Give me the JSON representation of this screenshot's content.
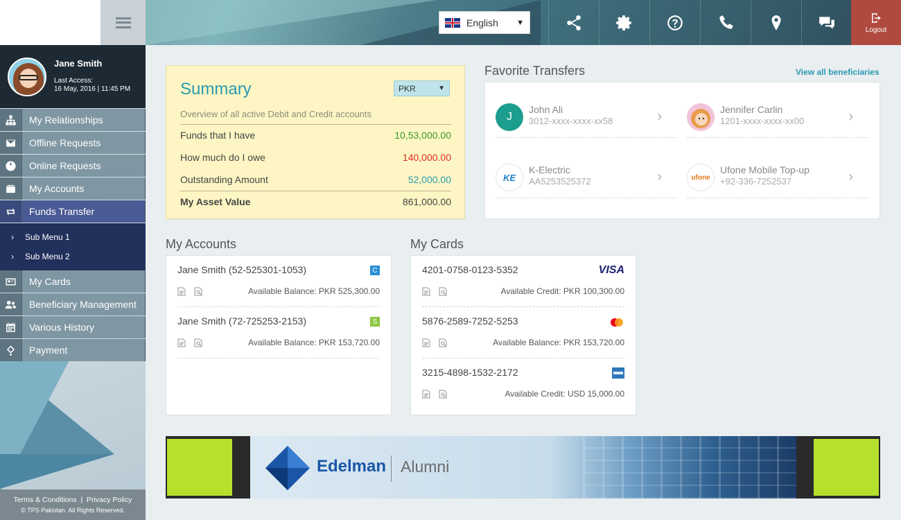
{
  "topbar": {
    "language": "English",
    "icons": [
      "share-icon",
      "gear-icon",
      "help-icon",
      "phone-icon",
      "location-icon",
      "chat-icon"
    ],
    "logout_label": "Logout"
  },
  "profile": {
    "name": "Jane Smith",
    "last_access_label": "Last Access:",
    "last_access_value": "16 May, 2016 | 11:45 PM"
  },
  "menu": {
    "items": [
      {
        "label": "My Relationships",
        "icon": "sitemap-icon"
      },
      {
        "label": "Offline Requests",
        "icon": "envelope-icon"
      },
      {
        "label": "Online Requests",
        "icon": "globe-icon"
      },
      {
        "label": "My Accounts",
        "icon": "wallet-icon"
      },
      {
        "label": "Funds Transfer",
        "icon": "transfer-icon"
      },
      {
        "label": "My Cards",
        "icon": "card-icon"
      },
      {
        "label": "Beneficiary Management",
        "icon": "users-icon"
      },
      {
        "label": "Various History",
        "icon": "calendar-icon"
      },
      {
        "label": "Payment",
        "icon": "payment-icon"
      }
    ],
    "submenu": [
      "Sub Menu 1",
      "Sub Menu 2"
    ]
  },
  "footer": {
    "terms": "Terms & Conditions",
    "sep": "|",
    "privacy": "Privacy Policy",
    "copyright": "© TPS Pakistan. All Rights Reserved."
  },
  "summary": {
    "title": "Summary",
    "currency": "PKR",
    "subtitle": "Overview of all active Debit and Credit accounts",
    "rows": [
      {
        "label": "Funds that I have",
        "value": "10,53,000.00",
        "color": "#3a9a2a"
      },
      {
        "label": "How much do I owe",
        "value": "140,000.00",
        "color": "#e02a2a"
      },
      {
        "label": "Outstanding Amount",
        "value": "52,000.00",
        "color": "#2a9ab0"
      }
    ],
    "asset_label": "My Asset Value",
    "asset_value": "861,000.00"
  },
  "favorites": {
    "title": "Favorite Transfers",
    "view_all": "View all beneficiaries",
    "items": [
      {
        "name": "John Ali",
        "account": "3012-xxxx-xxxx-xx58",
        "initial": "J"
      },
      {
        "name": "Jennifer Carlin",
        "account": "1201-xxxx-xxxx-xx00"
      },
      {
        "name": "K-Electric",
        "account": "AA5253525372",
        "logo": "KE"
      },
      {
        "name": "Ufone Mobile Top-up",
        "account": "+92-336-7252537",
        "logo": "ufone"
      }
    ]
  },
  "accounts": {
    "title": "My Accounts",
    "items": [
      {
        "name": "Jane Smith (52-525301-1053)",
        "badge": "C",
        "balance": "Available Balance: PKR 525,300.00"
      },
      {
        "name": "Jane Smith (72-725253-2153)",
        "badge": "S",
        "balance": "Available Balance: PKR 153,720.00"
      }
    ]
  },
  "cards": {
    "title": "My Cards",
    "items": [
      {
        "number": "4201-0758-0123-5352",
        "brand": "VISA",
        "balance": "Available Credit: PKR 100,300.00"
      },
      {
        "number": "5876-2589-7252-5253",
        "brand": "mastercard",
        "balance": "Available Balance: PKR 153,720.00"
      },
      {
        "number": "3215-4898-1532-2172",
        "brand": "amex",
        "balance": "Available Credit: USD 15,000.00"
      }
    ]
  },
  "banner": {
    "brand": "Edelman",
    "suffix": "Alumni"
  }
}
